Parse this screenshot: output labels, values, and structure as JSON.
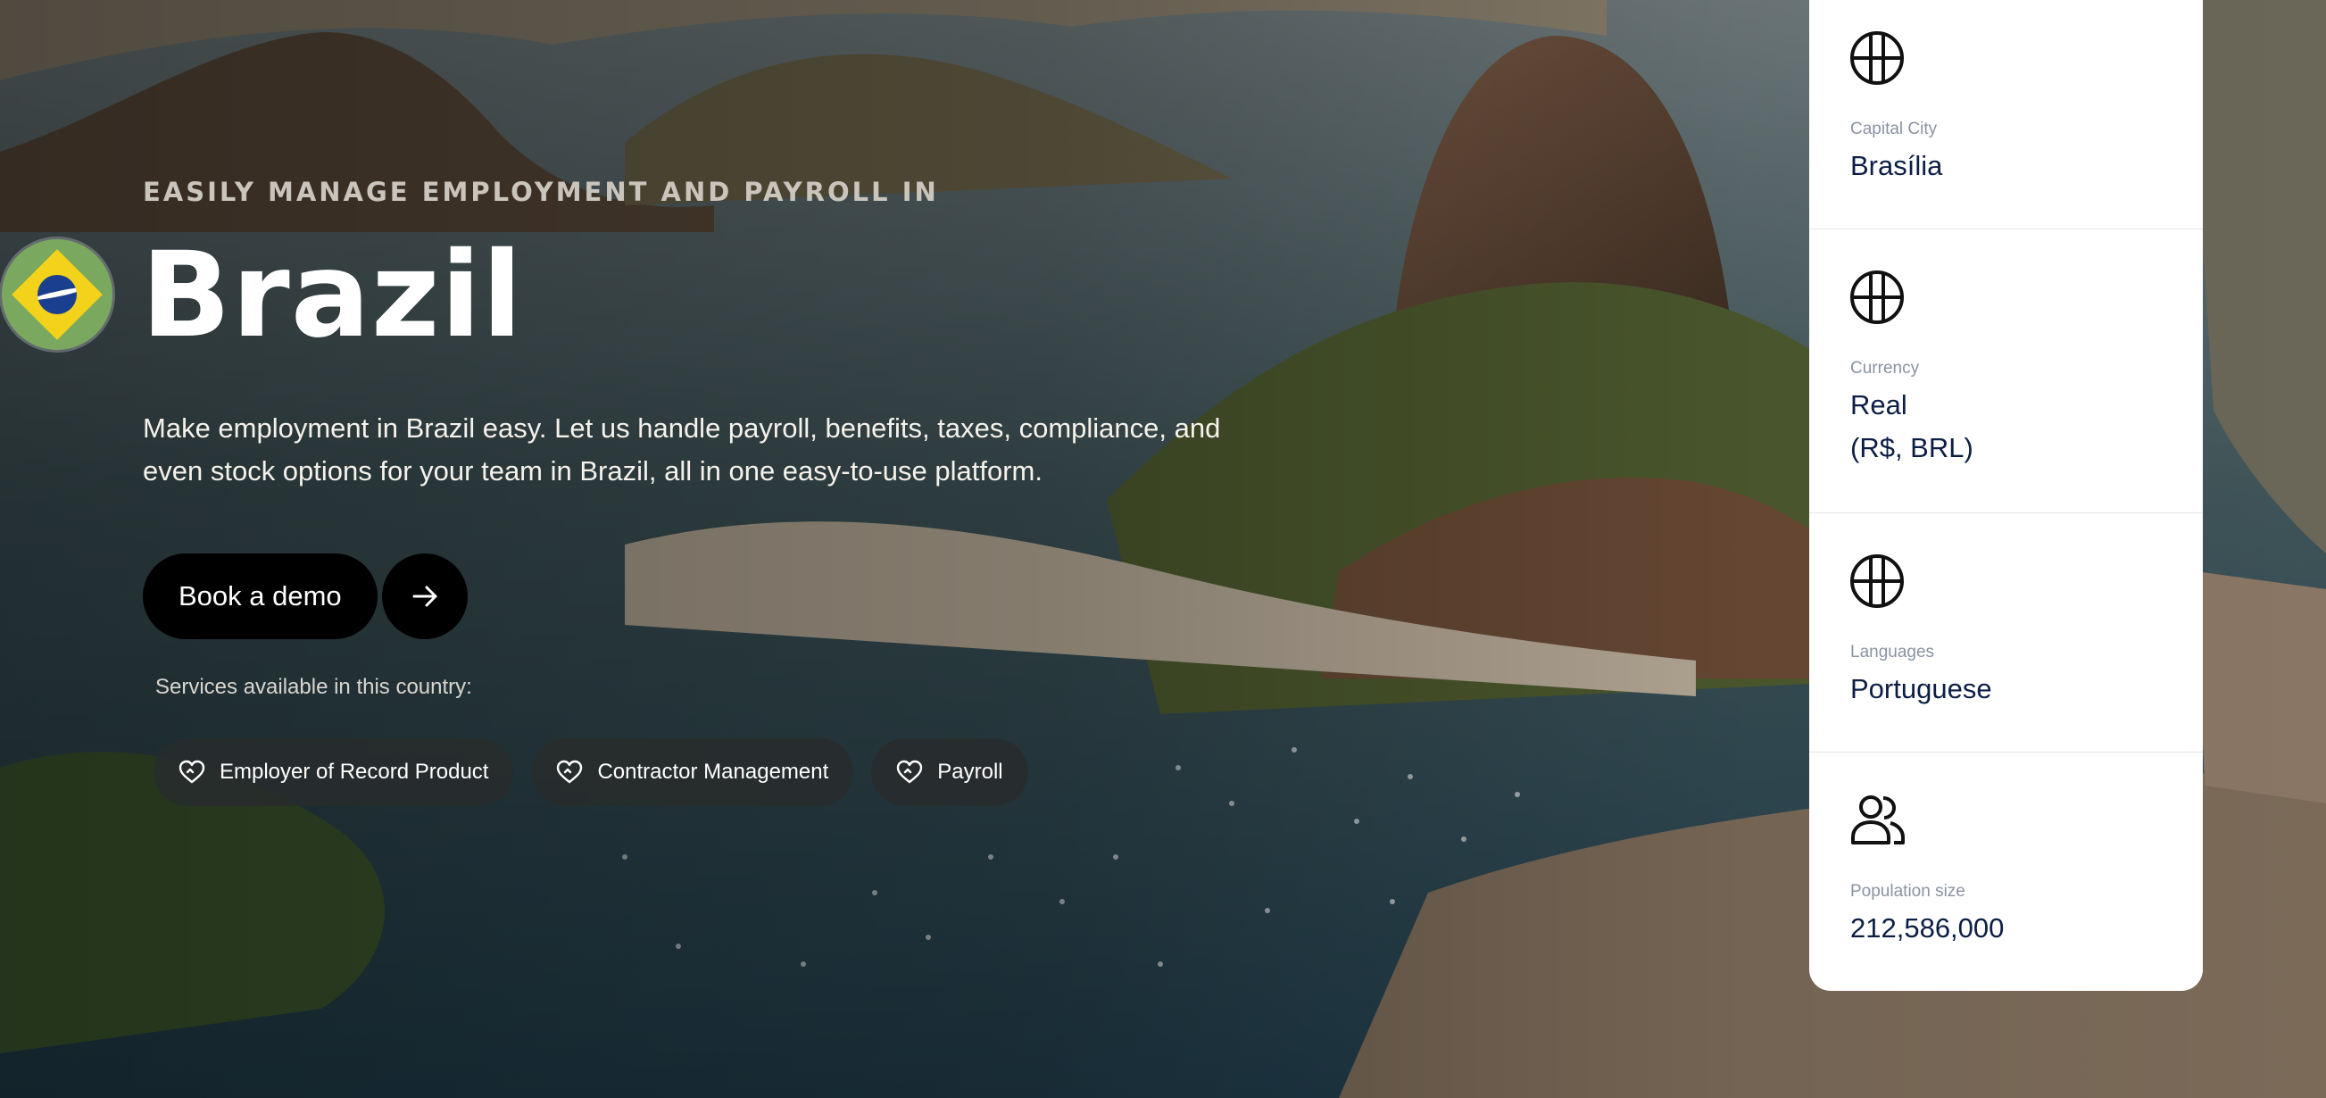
{
  "hero": {
    "eyebrow": "EASILY MANAGE EMPLOYMENT AND PAYROLL IN",
    "country": "Brazil",
    "description": "Make employment in Brazil easy. Let us handle payroll, benefits, taxes, compliance, and even stock options for your team in Brazil, all in one easy-to-use platform.",
    "cta_label": "Book a demo",
    "services_label": "Services available in this country:",
    "services": [
      "Employer of Record Product",
      "Contractor Management",
      "Payroll"
    ]
  },
  "facts": [
    {
      "icon": "globe-icon",
      "label": "Capital City",
      "value_lines": [
        "Brasília"
      ]
    },
    {
      "icon": "globe-icon",
      "label": "Currency",
      "value_lines": [
        "Real",
        "(R$, BRL)"
      ]
    },
    {
      "icon": "globe-icon",
      "label": "Languages",
      "value_lines": [
        "Portuguese"
      ]
    },
    {
      "icon": "users-icon",
      "label": "Population size",
      "value_lines": [
        "212,586,000"
      ]
    }
  ],
  "colors": {
    "cta_background": "#000000",
    "chip_background": "#2a2e2e",
    "card_background": "#ffffff",
    "fact_value": "#0c1e45",
    "fact_label": "#8a93a3"
  }
}
